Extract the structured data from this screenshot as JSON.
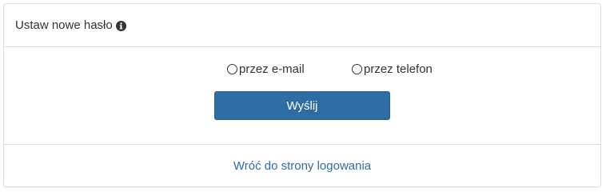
{
  "header": {
    "title": "Ustaw nowe hasło",
    "info_icon": "info-circle-icon"
  },
  "form": {
    "options": [
      {
        "label": "przez e-mail",
        "selected": false
      },
      {
        "label": "przez telefon",
        "selected": false
      }
    ],
    "submit_label": "Wyślij"
  },
  "footer": {
    "back_link": "Wróć do strony logowania"
  },
  "colors": {
    "primary": "#2e6da4",
    "border": "#dddddd",
    "text": "#333333"
  }
}
